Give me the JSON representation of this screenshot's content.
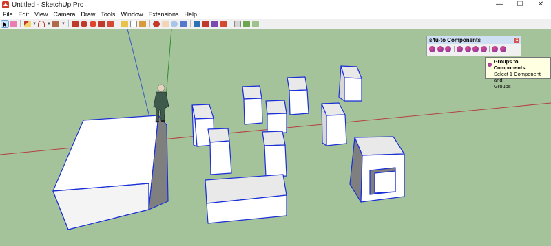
{
  "window": {
    "title": "Untitled - SketchUp Pro",
    "controls": {
      "minimize": "—",
      "maximize": "☐",
      "close": "✕"
    }
  },
  "menu": [
    "File",
    "Edit",
    "View",
    "Camera",
    "Draw",
    "Tools",
    "Window",
    "Extensions",
    "Help"
  ],
  "toolbar": {
    "icons": [
      "select-icon",
      "eraser-icon",
      "pencil-line-icon",
      "arc-icon",
      "rectangle-icon",
      "push-pull-icon",
      "move-icon",
      "rotate-icon",
      "scale-icon",
      "offset-icon",
      "tape-measure-icon",
      "text-icon",
      "paint-bucket-icon",
      "orbit-icon",
      "pan-icon",
      "zoom-icon",
      "zoom-extents-icon",
      "3d-warehouse-icon",
      "extension-warehouse-icon",
      "layout-icon",
      "extension-manager-icon",
      "solid-tools-icon",
      "sandbox-icon",
      "styles-icon"
    ]
  },
  "panel": {
    "title": "s4u-to Components",
    "close": "x"
  },
  "tooltip": {
    "title": "Groups to Components",
    "line1": "Select 1 Component and",
    "line2": "Groups"
  },
  "colors": {
    "sky_ground": "#a5c39b",
    "face_light": "#ffffff",
    "face_shade": "#7f7f7f",
    "edge_selected": "#1a2fd6",
    "axis_red": "#b34040",
    "axis_green": "#2f8f2f",
    "axis_blue": "#3a56c4"
  }
}
